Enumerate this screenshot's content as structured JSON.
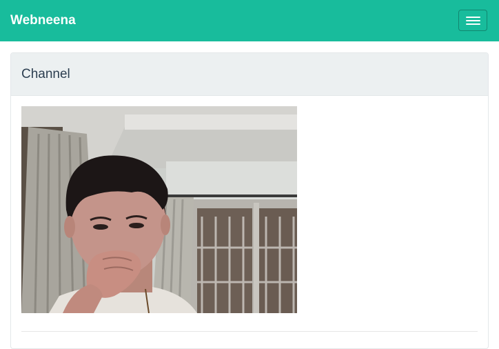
{
  "navbar": {
    "brand": "Webneena",
    "toggle_icon": "hamburger-menu-icon",
    "color": "#18bc9c"
  },
  "panel": {
    "title": "Channel",
    "heading_color": "#ecf0f1"
  },
  "video": {
    "content": "webcam-feed"
  }
}
